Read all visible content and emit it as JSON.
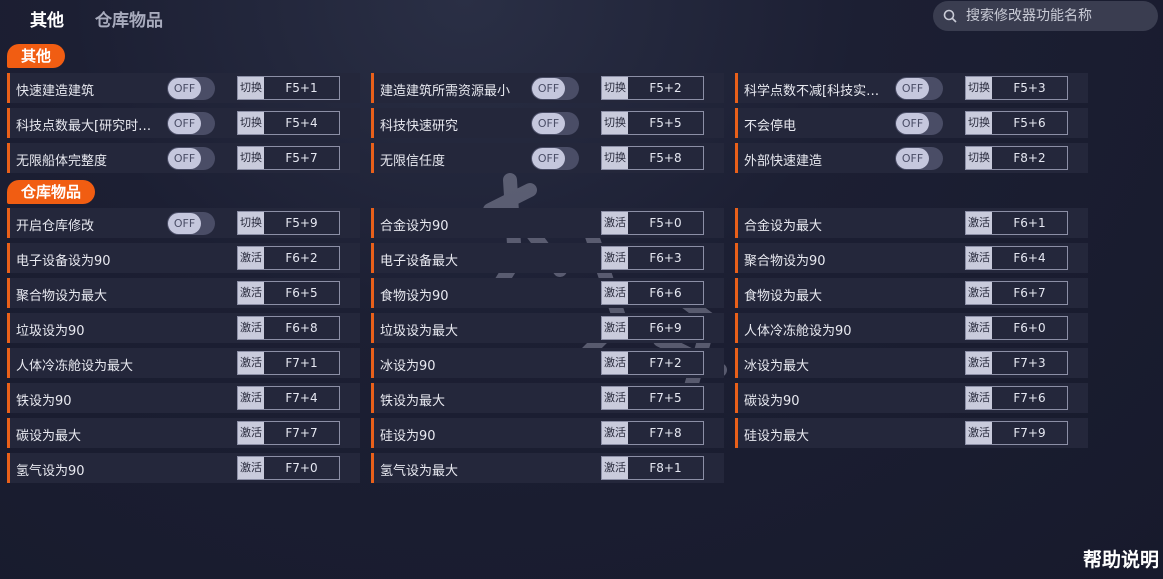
{
  "tabs": [
    "其他",
    "仓库物品"
  ],
  "search": {
    "placeholder": "搜索修改器功能名称"
  },
  "sections": {
    "other": {
      "label": "其他",
      "rows": [
        {
          "name": "快速建造建筑",
          "toggle": "OFF",
          "action": "切换",
          "key": "F5+1"
        },
        {
          "name": "建造建筑所需资源最小",
          "toggle": "OFF",
          "action": "切换",
          "key": "F5+2"
        },
        {
          "name": "科学点数不减[科技实…",
          "toggle": "OFF",
          "action": "切换",
          "key": "F5+3"
        },
        {
          "name": "科技点数最大[研究时…",
          "toggle": "OFF",
          "action": "切换",
          "key": "F5+4"
        },
        {
          "name": "科技快速研究",
          "toggle": "OFF",
          "action": "切换",
          "key": "F5+5"
        },
        {
          "name": "不会停电",
          "toggle": "OFF",
          "action": "切换",
          "key": "F5+6"
        },
        {
          "name": "无限船体完整度",
          "toggle": "OFF",
          "action": "切换",
          "key": "F5+7"
        },
        {
          "name": "无限信任度",
          "toggle": "OFF",
          "action": "切换",
          "key": "F5+8"
        },
        {
          "name": "外部快速建造",
          "toggle": "OFF",
          "action": "切换",
          "key": "F8+2"
        }
      ]
    },
    "warehouse": {
      "label": "仓库物品",
      "rows": [
        {
          "name": "开启仓库修改",
          "toggle": "OFF",
          "action": "切换",
          "key": "F5+9"
        },
        {
          "name": "合金设为90",
          "action": "激活",
          "key": "F5+0"
        },
        {
          "name": "合金设为最大",
          "action": "激活",
          "key": "F6+1"
        },
        {
          "name": "电子设备设为90",
          "action": "激活",
          "key": "F6+2"
        },
        {
          "name": "电子设备最大",
          "action": "激活",
          "key": "F6+3"
        },
        {
          "name": "聚合物设为90",
          "action": "激活",
          "key": "F6+4"
        },
        {
          "name": "聚合物设为最大",
          "action": "激活",
          "key": "F6+5"
        },
        {
          "name": "食物设为90",
          "action": "激活",
          "key": "F6+6"
        },
        {
          "name": "食物设为最大",
          "action": "激活",
          "key": "F6+7"
        },
        {
          "name": "垃圾设为90",
          "action": "激活",
          "key": "F6+8"
        },
        {
          "name": "垃圾设为最大",
          "action": "激活",
          "key": "F6+9"
        },
        {
          "name": "人体冷冻舱设为90",
          "action": "激活",
          "key": "F6+0"
        },
        {
          "name": "人体冷冻舱设为最大",
          "action": "激活",
          "key": "F7+1"
        },
        {
          "name": "冰设为90",
          "action": "激活",
          "key": "F7+2"
        },
        {
          "name": "冰设为最大",
          "action": "激活",
          "key": "F7+3"
        },
        {
          "name": "铁设为90",
          "action": "激活",
          "key": "F7+4"
        },
        {
          "name": "铁设为最大",
          "action": "激活",
          "key": "F7+5"
        },
        {
          "name": "碳设为90",
          "action": "激活",
          "key": "F7+6"
        },
        {
          "name": "碳设为最大",
          "action": "激活",
          "key": "F7+7"
        },
        {
          "name": "硅设为90",
          "action": "激活",
          "key": "F7+8"
        },
        {
          "name": "硅设为最大",
          "action": "激活",
          "key": "F7+9"
        },
        {
          "name": "氢气设为90",
          "action": "激活",
          "key": "F7+0"
        },
        {
          "name": "氢气设为最大",
          "action": "激活",
          "key": "F8+1"
        }
      ]
    }
  },
  "help_label": "帮助说明",
  "accent_color": "#f15d12"
}
